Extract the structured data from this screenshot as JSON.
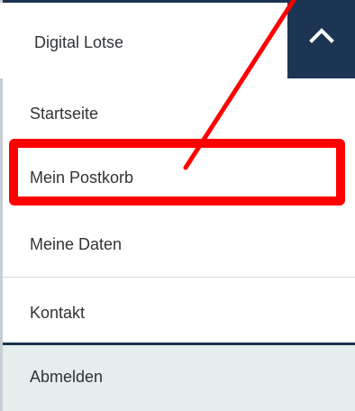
{
  "menu": {
    "title": "Digital Lotse",
    "collapse_icon": "chevron-up-icon",
    "items": [
      {
        "label": "Startseite"
      },
      {
        "label": "Mein Postkorb"
      },
      {
        "label": "Meine Daten"
      },
      {
        "label": "Kontakt"
      }
    ],
    "logout_label": "Abmelden"
  },
  "annotation": {
    "highlight_color": "#ff0000",
    "highlighted_item": "Mein Postkorb"
  },
  "colors": {
    "navy": "#1c3552",
    "logout_background": "#e7ecec",
    "divider": "#d4d9de"
  }
}
